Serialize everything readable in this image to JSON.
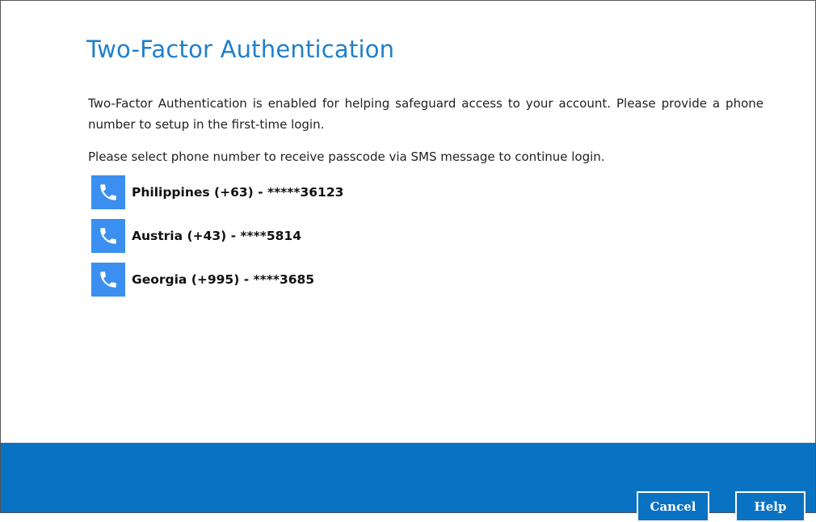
{
  "dialog": {
    "title": "Two-Factor Authentication",
    "description": "Two-Factor Authentication is enabled for helping safeguard access to your account. Please provide a phone number to setup in the first-time login.",
    "instruction": "Please select phone number to receive passcode via SMS message to continue login.",
    "phones": [
      {
        "label": "Philippines (+63) - *****36123",
        "icon": "phone-icon"
      },
      {
        "label": "Austria (+43) - ****5814",
        "icon": "phone-icon"
      },
      {
        "label": "Georgia (+995) - ****3685",
        "icon": "phone-icon"
      }
    ]
  },
  "footer": {
    "cancel_label": "Cancel",
    "help_label": "Help"
  },
  "colors": {
    "accent": "#1f7fcc",
    "footer_bg": "#0a72c2",
    "icon_bg": "#3b8ff0"
  }
}
